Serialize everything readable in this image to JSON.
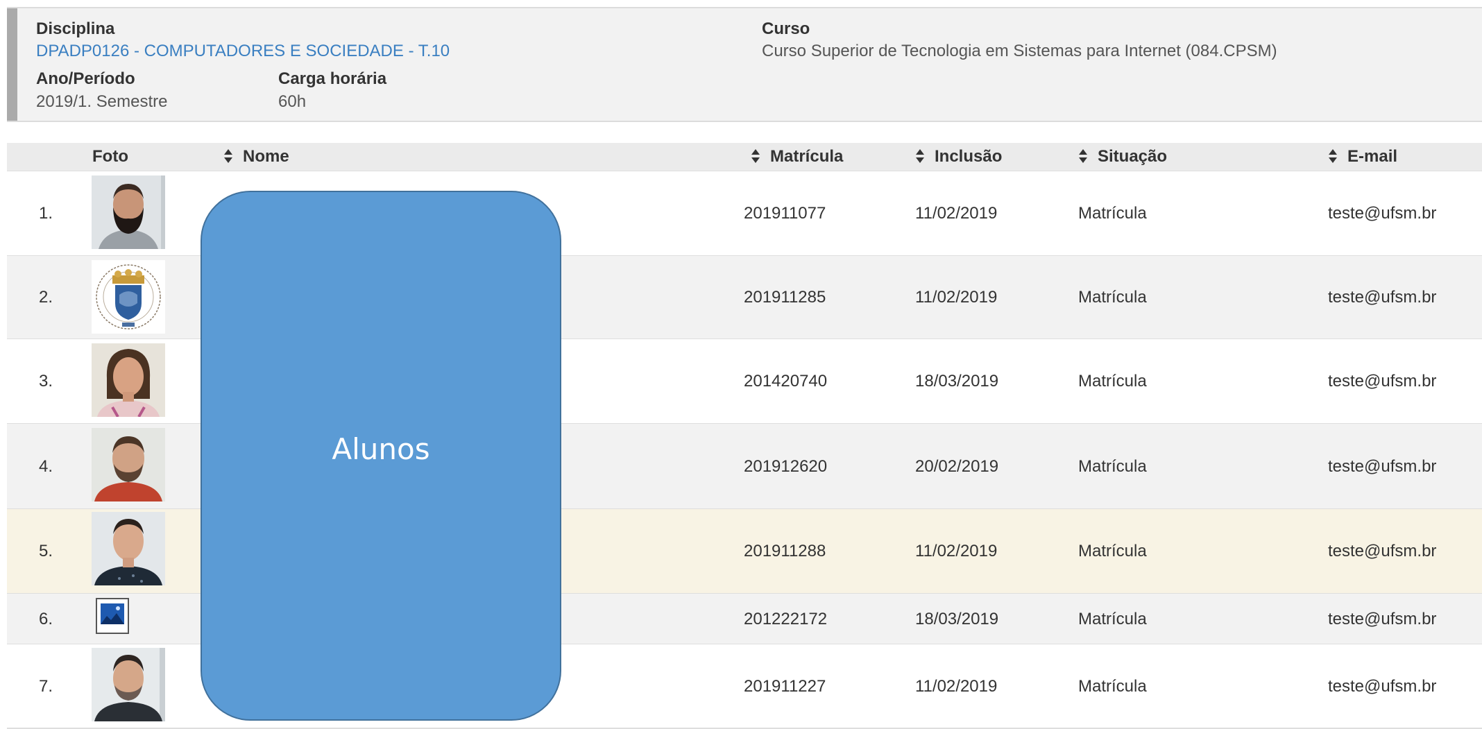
{
  "info": {
    "disciplina_label": "Disciplina",
    "disciplina_value": "DPADP0126 - COMPUTADORES E SOCIEDADE - T.10",
    "curso_label": "Curso",
    "curso_value": "Curso Superior de Tecnologia em Sistemas para Internet (084.CPSM)",
    "ano_label": "Ano/Período",
    "ano_value": "2019/1. Semestre",
    "carga_label": "Carga horária",
    "carga_value": "60h"
  },
  "table": {
    "headers": {
      "foto": "Foto",
      "nome": "Nome",
      "matricula": "Matrícula",
      "inclusao": "Inclusão",
      "situacao": "Situação",
      "email": "E-mail"
    },
    "rows": [
      {
        "num": "1.",
        "photo": "photo-bearded-man",
        "matricula": "201911077",
        "inclusao": "11/02/2019",
        "situacao": "Matrícula",
        "email": "teste@ufsm.br"
      },
      {
        "num": "2.",
        "photo": "university-seal",
        "matricula": "201911285",
        "inclusao": "11/02/2019",
        "situacao": "Matrícula",
        "email": "teste@ufsm.br"
      },
      {
        "num": "3.",
        "photo": "photo-woman",
        "matricula": "201420740",
        "inclusao": "18/03/2019",
        "situacao": "Matrícula",
        "email": "teste@ufsm.br"
      },
      {
        "num": "4.",
        "photo": "photo-man-red-shirt",
        "matricula": "201912620",
        "inclusao": "20/02/2019",
        "situacao": "Matrícula",
        "email": "teste@ufsm.br"
      },
      {
        "num": "5.",
        "photo": "photo-man-dark-shirt",
        "matricula": "201911288",
        "inclusao": "11/02/2019",
        "situacao": "Matrícula",
        "email": "teste@ufsm.br"
      },
      {
        "num": "6.",
        "photo": "placeholder-image-icon",
        "matricula": "201222172",
        "inclusao": "18/03/2019",
        "situacao": "Matrícula",
        "email": "teste@ufsm.br"
      },
      {
        "num": "7.",
        "photo": "photo-young-man",
        "matricula": "201911227",
        "inclusao": "11/02/2019",
        "situacao": "Matrícula",
        "email": "teste@ufsm.br"
      }
    ]
  },
  "overlay": {
    "label": "Alunos",
    "fill": "#5b9bd5"
  },
  "colors": {
    "link": "#3a7fc1",
    "highlight_row": "#f8f3e4"
  }
}
